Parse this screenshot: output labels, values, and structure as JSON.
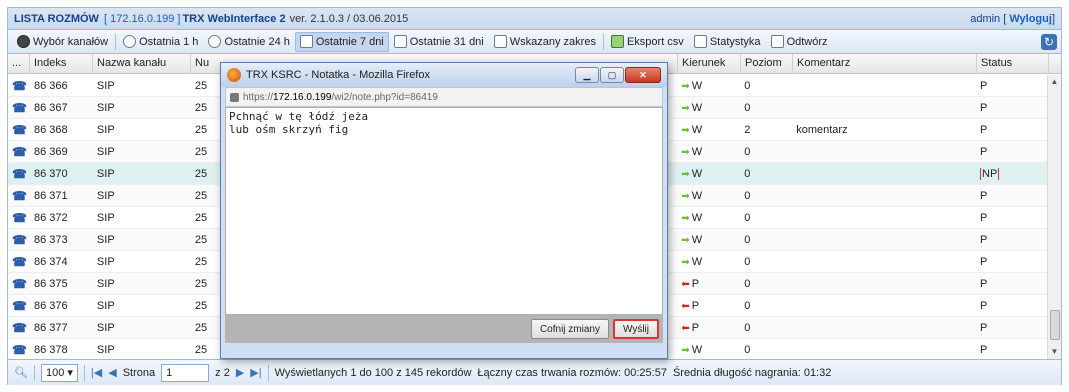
{
  "header": {
    "title": "LISTA ROZMÓW",
    "ip": "[ 172.16.0.199 ]",
    "app": "TRX WebInterface 2",
    "version": "ver. 2.1.0.3 / 03.06.2015",
    "user": "admin [",
    "logout": "Wyloguj",
    "user_close": "]"
  },
  "toolbar": [
    {
      "label": "Wybór kanałów",
      "icon": "gear-icon"
    },
    {
      "label": "Ostatnia 1 h",
      "icon": "clock-icon"
    },
    {
      "label": "Ostatnie 24 h",
      "icon": "clock-24-icon"
    },
    {
      "label": "Ostatnie 7 dni",
      "icon": "calendar-7-icon",
      "active": true
    },
    {
      "label": "Ostatnie 31 dni",
      "icon": "calendar-31-icon"
    },
    {
      "label": "Wskazany zakres",
      "icon": "calendar-icon"
    },
    {
      "label": "Eksport csv",
      "icon": "export-icon"
    },
    {
      "label": "Statystyka",
      "icon": "chart-icon"
    },
    {
      "label": "Odtwórz",
      "icon": "play-icon"
    }
  ],
  "columns": {
    "dots": "...",
    "index": "Indeks",
    "channel": "Nazwa kanału",
    "number": "Nu",
    "direction": "Kierunek",
    "level": "Poziom",
    "comment": "Komentarz",
    "status": "Status"
  },
  "rows": [
    {
      "index": "86 366",
      "channel": "SIP",
      "num": "25",
      "dir": "W",
      "dir_type": "in",
      "level": "0",
      "comment": "",
      "status": "P"
    },
    {
      "index": "86 367",
      "channel": "SIP",
      "num": "25",
      "dir": "W",
      "dir_type": "in",
      "level": "0",
      "comment": "",
      "status": "P"
    },
    {
      "index": "86 368",
      "channel": "SIP",
      "num": "25",
      "dir": "W",
      "dir_type": "in",
      "level": "2",
      "comment": "komentarz",
      "status": "P"
    },
    {
      "index": "86 369",
      "channel": "SIP",
      "num": "25",
      "dir": "W",
      "dir_type": "in",
      "level": "0",
      "comment": "",
      "status": "P"
    },
    {
      "index": "86 370",
      "channel": "SIP",
      "num": "25",
      "dir": "W",
      "dir_type": "in",
      "level": "0",
      "comment": "",
      "status": "NP",
      "selected": true
    },
    {
      "index": "86 371",
      "channel": "SIP",
      "num": "25",
      "dir": "W",
      "dir_type": "in",
      "level": "0",
      "comment": "",
      "status": "P"
    },
    {
      "index": "86 372",
      "channel": "SIP",
      "num": "25",
      "dir": "W",
      "dir_type": "in",
      "level": "0",
      "comment": "",
      "status": "P"
    },
    {
      "index": "86 373",
      "channel": "SIP",
      "num": "25",
      "dir": "W",
      "dir_type": "in",
      "level": "0",
      "comment": "",
      "status": "P"
    },
    {
      "index": "86 374",
      "channel": "SIP",
      "num": "25",
      "dir": "W",
      "dir_type": "in",
      "level": "0",
      "comment": "",
      "status": "P"
    },
    {
      "index": "86 375",
      "channel": "SIP",
      "num": "25",
      "dir": "P",
      "dir_type": "out",
      "level": "0",
      "comment": "",
      "status": "P"
    },
    {
      "index": "86 376",
      "channel": "SIP",
      "num": "25",
      "dir": "P",
      "dir_type": "out",
      "level": "0",
      "comment": "",
      "status": "P"
    },
    {
      "index": "86 377",
      "channel": "SIP",
      "num": "25",
      "dir": "P",
      "dir_type": "out",
      "level": "0",
      "comment": "",
      "status": "P"
    },
    {
      "index": "86 378",
      "channel": "SIP",
      "num": "25",
      "dir": "W",
      "dir_type": "in",
      "level": "0",
      "comment": "",
      "status": "P"
    }
  ],
  "pager": {
    "page_size": "100",
    "page_label": "Strona",
    "page_value": "1",
    "of": "z 2",
    "displayed": "Wyświetlanych 1 do 100 z 145 rekordów",
    "total_time": "Łączny czas trwania rozmów: 00:25:57",
    "avg_len": "Średnia długość nagrania: 01:32"
  },
  "popup": {
    "title": "TRX KSRC - Notatka - Mozilla Firefox",
    "url_pre": "https://",
    "url_host": "172.16.0.199",
    "url_post": "/wi2/note.php?id=86419",
    "text": "Pchnąć w tę łódź jeża\nlub ośm skrzyń fig",
    "cancel": "Cofnij zmiany",
    "send": "Wyślij"
  },
  "colors": {
    "accent": "#15428b",
    "link": "#1a5fc2",
    "in_dir": "#6bbf2c",
    "out_dir": "#d32020"
  }
}
